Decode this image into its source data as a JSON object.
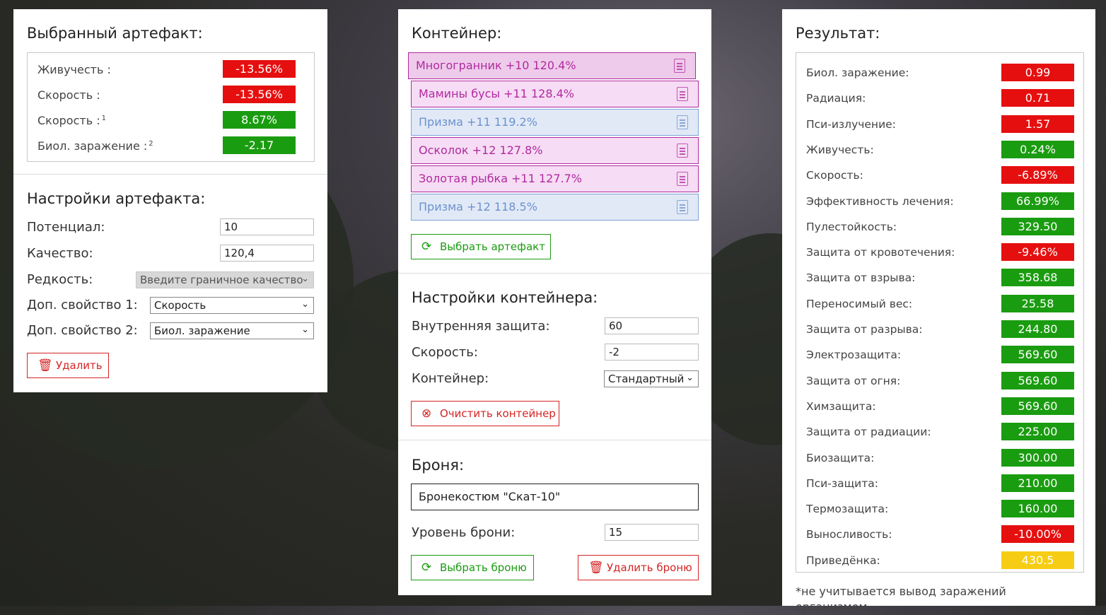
{
  "selected_artifact": {
    "title": "Выбранный артефакт:",
    "stats": [
      {
        "label": "Живучесть :",
        "sup": "",
        "value": "-13.56%",
        "color": "red"
      },
      {
        "label": "Скорость :",
        "sup": "",
        "value": "-13.56%",
        "color": "red"
      },
      {
        "label": "Скорость :",
        "sup": "1",
        "value": "8.67%",
        "color": "green"
      },
      {
        "label": "Биол. заражение :",
        "sup": "2",
        "value": "-2.17",
        "color": "green"
      }
    ]
  },
  "artifact_settings": {
    "title": "Настройки артефакта:",
    "potential_label": "Потенциал:",
    "potential_value": "10",
    "quality_label": "Качество:",
    "quality_value": "120,4",
    "rarity_label": "Редкость:",
    "rarity_placeholder": "Введите граничное качество",
    "extra1_label": "Доп. свойство 1:",
    "extra1_value": "Скорость",
    "extra2_label": "Доп. свойство 2:",
    "extra2_value": "Биол. заражение",
    "delete_label": "Удалить"
  },
  "container": {
    "title": "Контейнер:",
    "artifacts": [
      {
        "label": "Многогранник +10 120.4%",
        "color": "purple"
      },
      {
        "label": "Мамины бусы +11 128.4%",
        "color": "purple"
      },
      {
        "label": "Призма +11 119.2%",
        "color": "blue"
      },
      {
        "label": "Осколок +12 127.8%",
        "color": "purple"
      },
      {
        "label": "Золотая рыбка +11 127.7%",
        "color": "purple"
      },
      {
        "label": "Призма +12 118.5%",
        "color": "blue"
      }
    ],
    "choose_label": "Выбрать артефакт"
  },
  "container_settings": {
    "title": "Настройки контейнера:",
    "inner_protection_label": "Внутренняя защита:",
    "inner_protection_value": "60",
    "speed_label": "Скорость:",
    "speed_value": "-2",
    "container_label": "Контейнер:",
    "container_value": "Стандартный",
    "clear_label": "Очистить контейнер"
  },
  "armor": {
    "title": "Броня:",
    "name": "Бронекостюм \"Скат-10\"",
    "level_label": "Уровень брони:",
    "level_value": "15",
    "choose_label": "Выбрать броню",
    "delete_label": "Удалить броню"
  },
  "result": {
    "title": "Результат:",
    "rows": [
      {
        "label": "Биол. заражение:",
        "value": "0.99",
        "color": "red"
      },
      {
        "label": "Радиация:",
        "value": "0.71",
        "color": "red"
      },
      {
        "label": "Пси-излучение:",
        "value": "1.57",
        "color": "red"
      },
      {
        "label": "Живучесть:",
        "value": "0.24%",
        "color": "green"
      },
      {
        "label": "Скорость:",
        "value": "-6.89%",
        "color": "red"
      },
      {
        "label": "Эффективность лечения:",
        "value": "66.99%",
        "color": "green"
      },
      {
        "label": "Пулестойкость:",
        "value": "329.50",
        "color": "green"
      },
      {
        "label": "Защита от кровотечения:",
        "value": "-9.46%",
        "color": "red"
      },
      {
        "label": "Защита от взрыва:",
        "value": "358.68",
        "color": "green"
      },
      {
        "label": "Переносимый вес:",
        "value": "25.58",
        "color": "green"
      },
      {
        "label": "Защита от разрыва:",
        "value": "244.80",
        "color": "green"
      },
      {
        "label": "Электрозащита:",
        "value": "569.60",
        "color": "green"
      },
      {
        "label": "Защита от огня:",
        "value": "569.60",
        "color": "green"
      },
      {
        "label": "Химзащита:",
        "value": "569.60",
        "color": "green"
      },
      {
        "label": "Защита от радиации:",
        "value": "225.00",
        "color": "green"
      },
      {
        "label": "Биозащита:",
        "value": "300.00",
        "color": "green"
      },
      {
        "label": "Пси-защита:",
        "value": "210.00",
        "color": "green"
      },
      {
        "label": "Термозащита:",
        "value": "160.00",
        "color": "green"
      },
      {
        "label": "Выносливость:",
        "value": "-10.00%",
        "color": "red"
      },
      {
        "label": "Приведёнка:",
        "value": "430.5",
        "color": "yellow"
      }
    ],
    "footnote": "*не учитывается вывод заражений организмом"
  },
  "colors": {
    "red": "#e60f0f",
    "green": "#1a9c10",
    "yellow": "#f6cd14",
    "purple": "#b12aa0",
    "blue": "#6a93cf"
  }
}
